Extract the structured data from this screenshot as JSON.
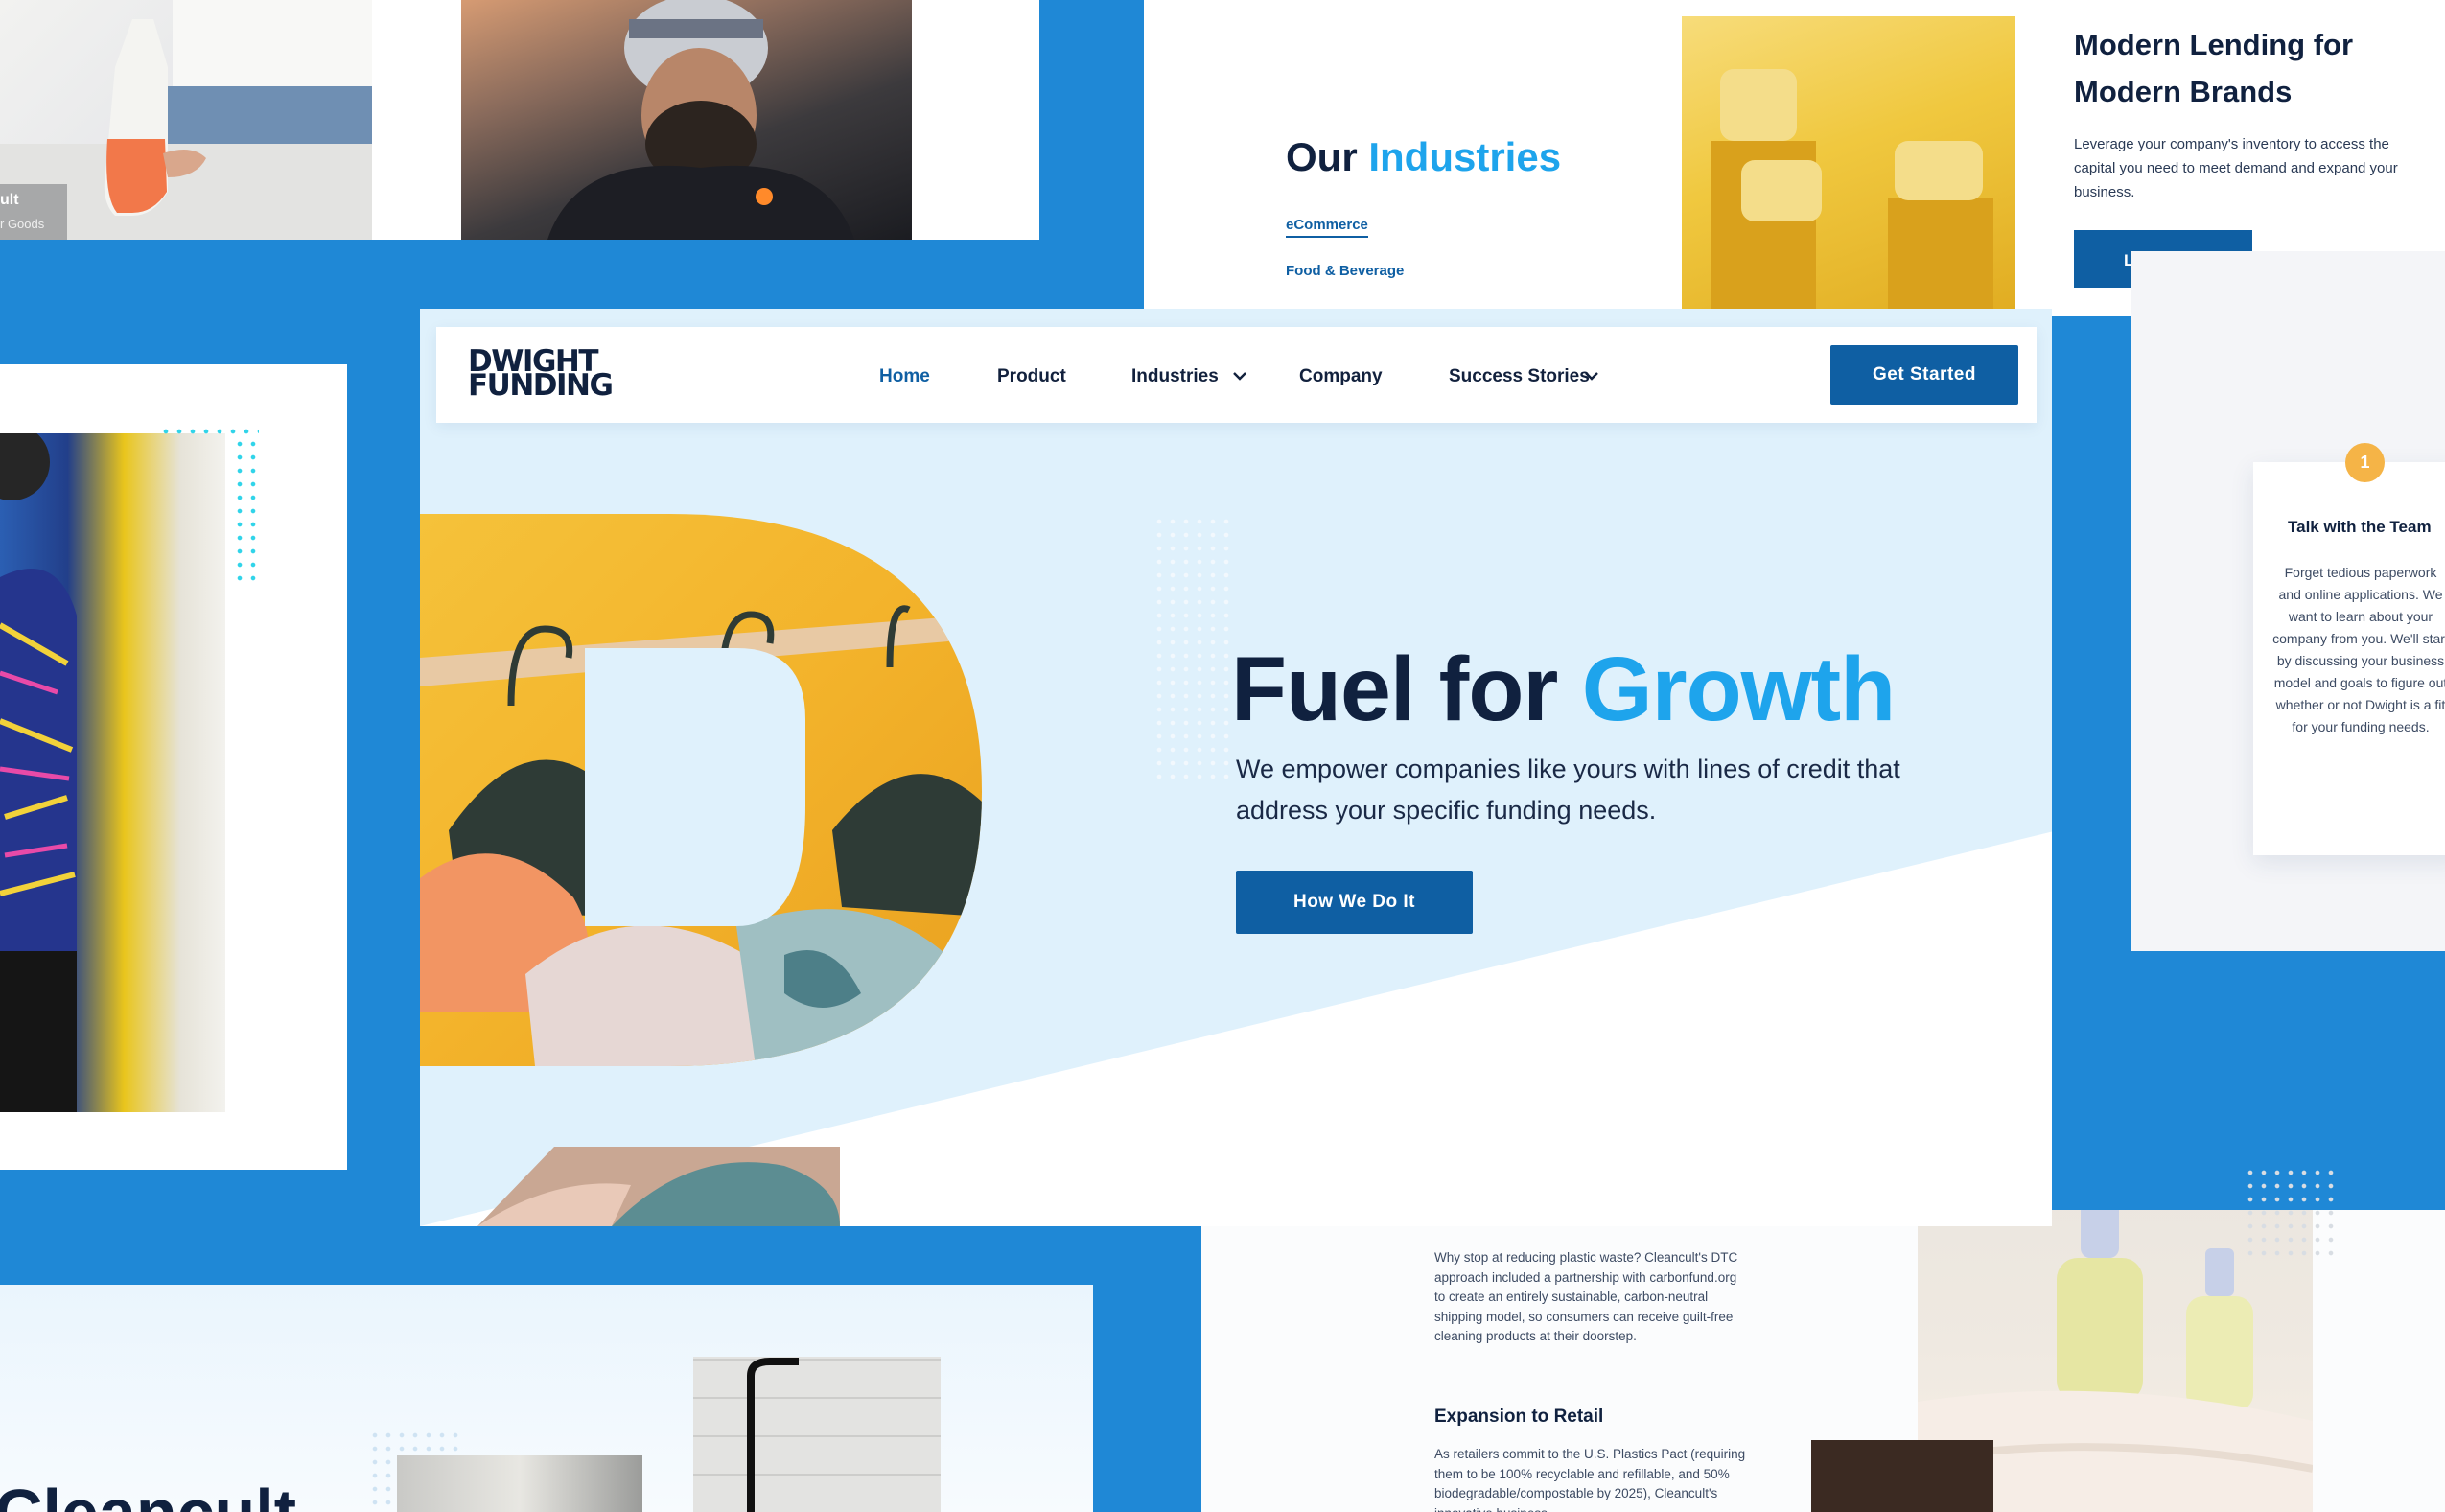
{
  "brand": {
    "line1": "DWIGHT",
    "line2": "FUNDING"
  },
  "nav": {
    "items": [
      {
        "label": "Home"
      },
      {
        "label": "Product"
      },
      {
        "label": "Industries"
      },
      {
        "label": "Company"
      },
      {
        "label": "Success Stories"
      }
    ],
    "cta": "Get Started"
  },
  "hero": {
    "headline_part1": "Fuel for ",
    "headline_part2": "Growth",
    "subtext": "We empower companies like yours with lines of credit that address your specific funding needs.",
    "button": "How We Do It"
  },
  "industries_panel": {
    "title_part1": "Our ",
    "title_part2": "Industries",
    "links": [
      "eCommerce",
      "Food & Beverage"
    ]
  },
  "lending_panel": {
    "title": "Modern Lending for Modern Brands",
    "body": "Leverage your company's inventory to access the capital you need to meet demand and expand your business.",
    "button_partial": "L"
  },
  "team_card": {
    "step": "1",
    "title": "Talk with the Team",
    "body": "Forget tedious paperwork and online applications. We want to learn about your company from you. We'll start by discussing your business model and goals to figure out whether or not Dwight is a fit for your funding needs."
  },
  "case_study": {
    "paragraph": "Why stop at reducing plastic waste? Cleancult's DTC approach included a partnership with carbonfund.org to create an entirely sustainable, carbon-neutral shipping model, so consumers can receive guilt-free cleaning products at their doorstep.",
    "heading": "Expansion to Retail",
    "paragraph2": "As retailers commit to the U.S. Plastics Pact (requiring them to be 100% recyclable and refillable, and 50% biodegradable/compostable by 2025), Cleancult's innovative business"
  },
  "corner_label": {
    "line1": "ult",
    "line2": "r Goods"
  },
  "bottom_title": "Cleancult",
  "colors": {
    "primary": "#0f5fa3",
    "accent": "#1ea4ec",
    "navy": "#10213f",
    "background": "#1f88d6",
    "hero_bg": "#dff1fc",
    "step_badge": "#f5b447"
  }
}
